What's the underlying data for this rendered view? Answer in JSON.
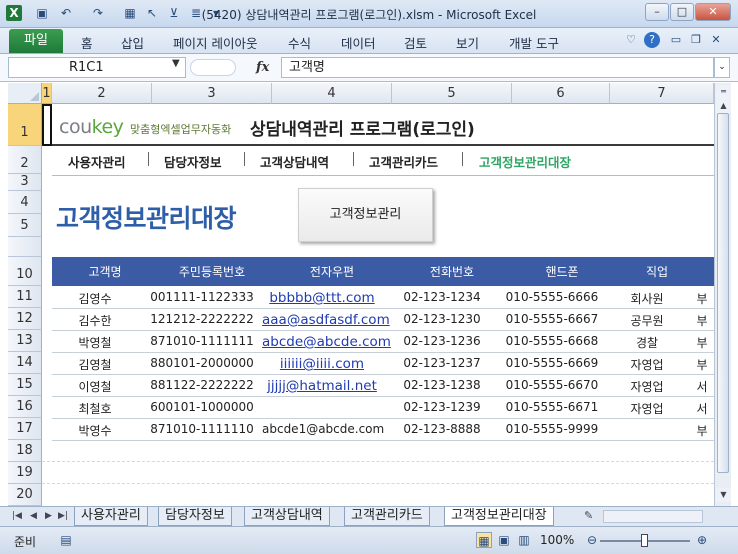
{
  "window": {
    "title": "(5420) 상담내역관리 프로그램(로그인).xlsm  -  Microsoft Excel",
    "min_label": "–",
    "max_label": "□",
    "close_label": "✕"
  },
  "ribbon": {
    "tabs": [
      "파일",
      "홈",
      "삽입",
      "페이지 레이아웃",
      "수식",
      "데이터",
      "검토",
      "보기",
      "개발 도구"
    ]
  },
  "formula_bar": {
    "name_box": "R1C1",
    "fx_label": "fx",
    "formula": "고객명"
  },
  "columns": [
    "1",
    "2",
    "3",
    "4",
    "5",
    "6",
    "7"
  ],
  "rows": [
    "1",
    "2",
    "3",
    "4",
    "5",
    "",
    "10",
    "11",
    "12",
    "13",
    "14",
    "15",
    "16",
    "17",
    "18",
    "19",
    "20"
  ],
  "sheet": {
    "logo_main": "cou",
    "logo_key": "key",
    "logo_sub": "맞춤형엑셀업무자동화",
    "app_title": "상담내역관리 프로그램(로그인)",
    "nav": [
      "사용자관리",
      "담당자정보",
      "고객상담내역",
      "고객관리카드",
      "고객정보관리대장"
    ],
    "active_nav_color": "#2ea564",
    "page_title": "고객정보관리대장",
    "manage_button": "고객정보관리",
    "table_headers": [
      "고객명",
      "주민등록번호",
      "전자우편",
      "전화번호",
      "핸드폰",
      "직업"
    ],
    "header_color": "#3b5ba5",
    "table_rows": [
      {
        "name": "김영수",
        "rrn": "001111-1122333",
        "email": "bbbbb@ttt.com",
        "email_link": true,
        "phone": "02-123-1234",
        "mobile": "010-5555-6666",
        "job": "회사원",
        "extra": "부"
      },
      {
        "name": "김수한",
        "rrn": "121212-2222222",
        "email": "aaa@asdfasdf.com",
        "email_link": true,
        "phone": "02-123-1230",
        "mobile": "010-5555-6667",
        "job": "공무원",
        "extra": "부"
      },
      {
        "name": "박영철",
        "rrn": "871010-1111111",
        "email": "abcde@abcde.com",
        "email_link": true,
        "phone": "02-123-1236",
        "mobile": "010-5555-6668",
        "job": "경찰",
        "extra": "부"
      },
      {
        "name": "김영철",
        "rrn": "880101-2000000",
        "email": "iiiiii@iiii.com",
        "email_link": true,
        "phone": "02-123-1237",
        "mobile": "010-5555-6669",
        "job": "자영업",
        "extra": "부"
      },
      {
        "name": "이영철",
        "rrn": "881122-2222222",
        "email": "jjjjj@hatmail.net",
        "email_link": true,
        "phone": "02-123-1238",
        "mobile": "010-5555-6670",
        "job": "자영업",
        "extra": "서"
      },
      {
        "name": "최철호",
        "rrn": "600101-1000000",
        "email": "",
        "email_link": false,
        "phone": "02-123-1239",
        "mobile": "010-5555-6671",
        "job": "자영업",
        "extra": "서"
      },
      {
        "name": "박영수",
        "rrn": "871010-1111110",
        "email": "abcde1@abcde.com",
        "email_link": false,
        "phone": "02-123-8888",
        "mobile": "010-5555-9999",
        "job": "",
        "extra": "부"
      }
    ]
  },
  "sheet_tabs": [
    "사용자관리",
    "담당자정보",
    "고객상담내역",
    "고객관리카드",
    "고객정보관리대장"
  ],
  "active_sheet": "고객정보관리대장",
  "status": {
    "ready": "준비",
    "zoom": "100%"
  }
}
